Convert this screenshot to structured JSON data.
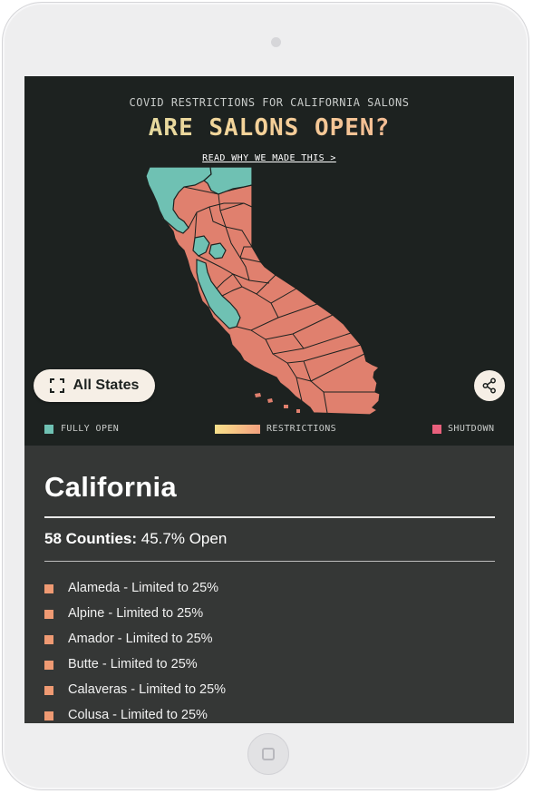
{
  "header": {
    "kicker": "COVID RESTRICTIONS FOR CALIFORNIA SALONS",
    "headline": "ARE SALONS OPEN?",
    "read_why_link": "READ WHY WE MADE THIS >"
  },
  "map_controls": {
    "all_states_label": "All States",
    "share_icon": "share-icon",
    "expand_icon": "expand-icon"
  },
  "legend": {
    "fully_open": "FULLY OPEN",
    "restrictions": "RESTRICTIONS",
    "shutdown": "SHUTDOWN"
  },
  "colors": {
    "fully_open": "#6fc1b3",
    "restrictions_gradient": [
      "#f7e08b",
      "#f8cc86",
      "#f6b483",
      "#f2a17e"
    ],
    "shutdown": "#e9607c",
    "restricted_county": "#e0806e",
    "county_marker": "#ef9a73",
    "screen_bg": "#1d2220",
    "panel_bg": "#353736"
  },
  "panel": {
    "state_name": "California",
    "counties_count_label": "58 Counties:",
    "open_percent_text": "45.7% Open",
    "counties": [
      "Alameda - Limited to 25%",
      "Alpine - Limited to 25%",
      "Amador - Limited to 25%",
      "Butte - Limited to 25%",
      "Calaveras - Limited to 25%",
      "Colusa - Limited to 25%"
    ]
  }
}
